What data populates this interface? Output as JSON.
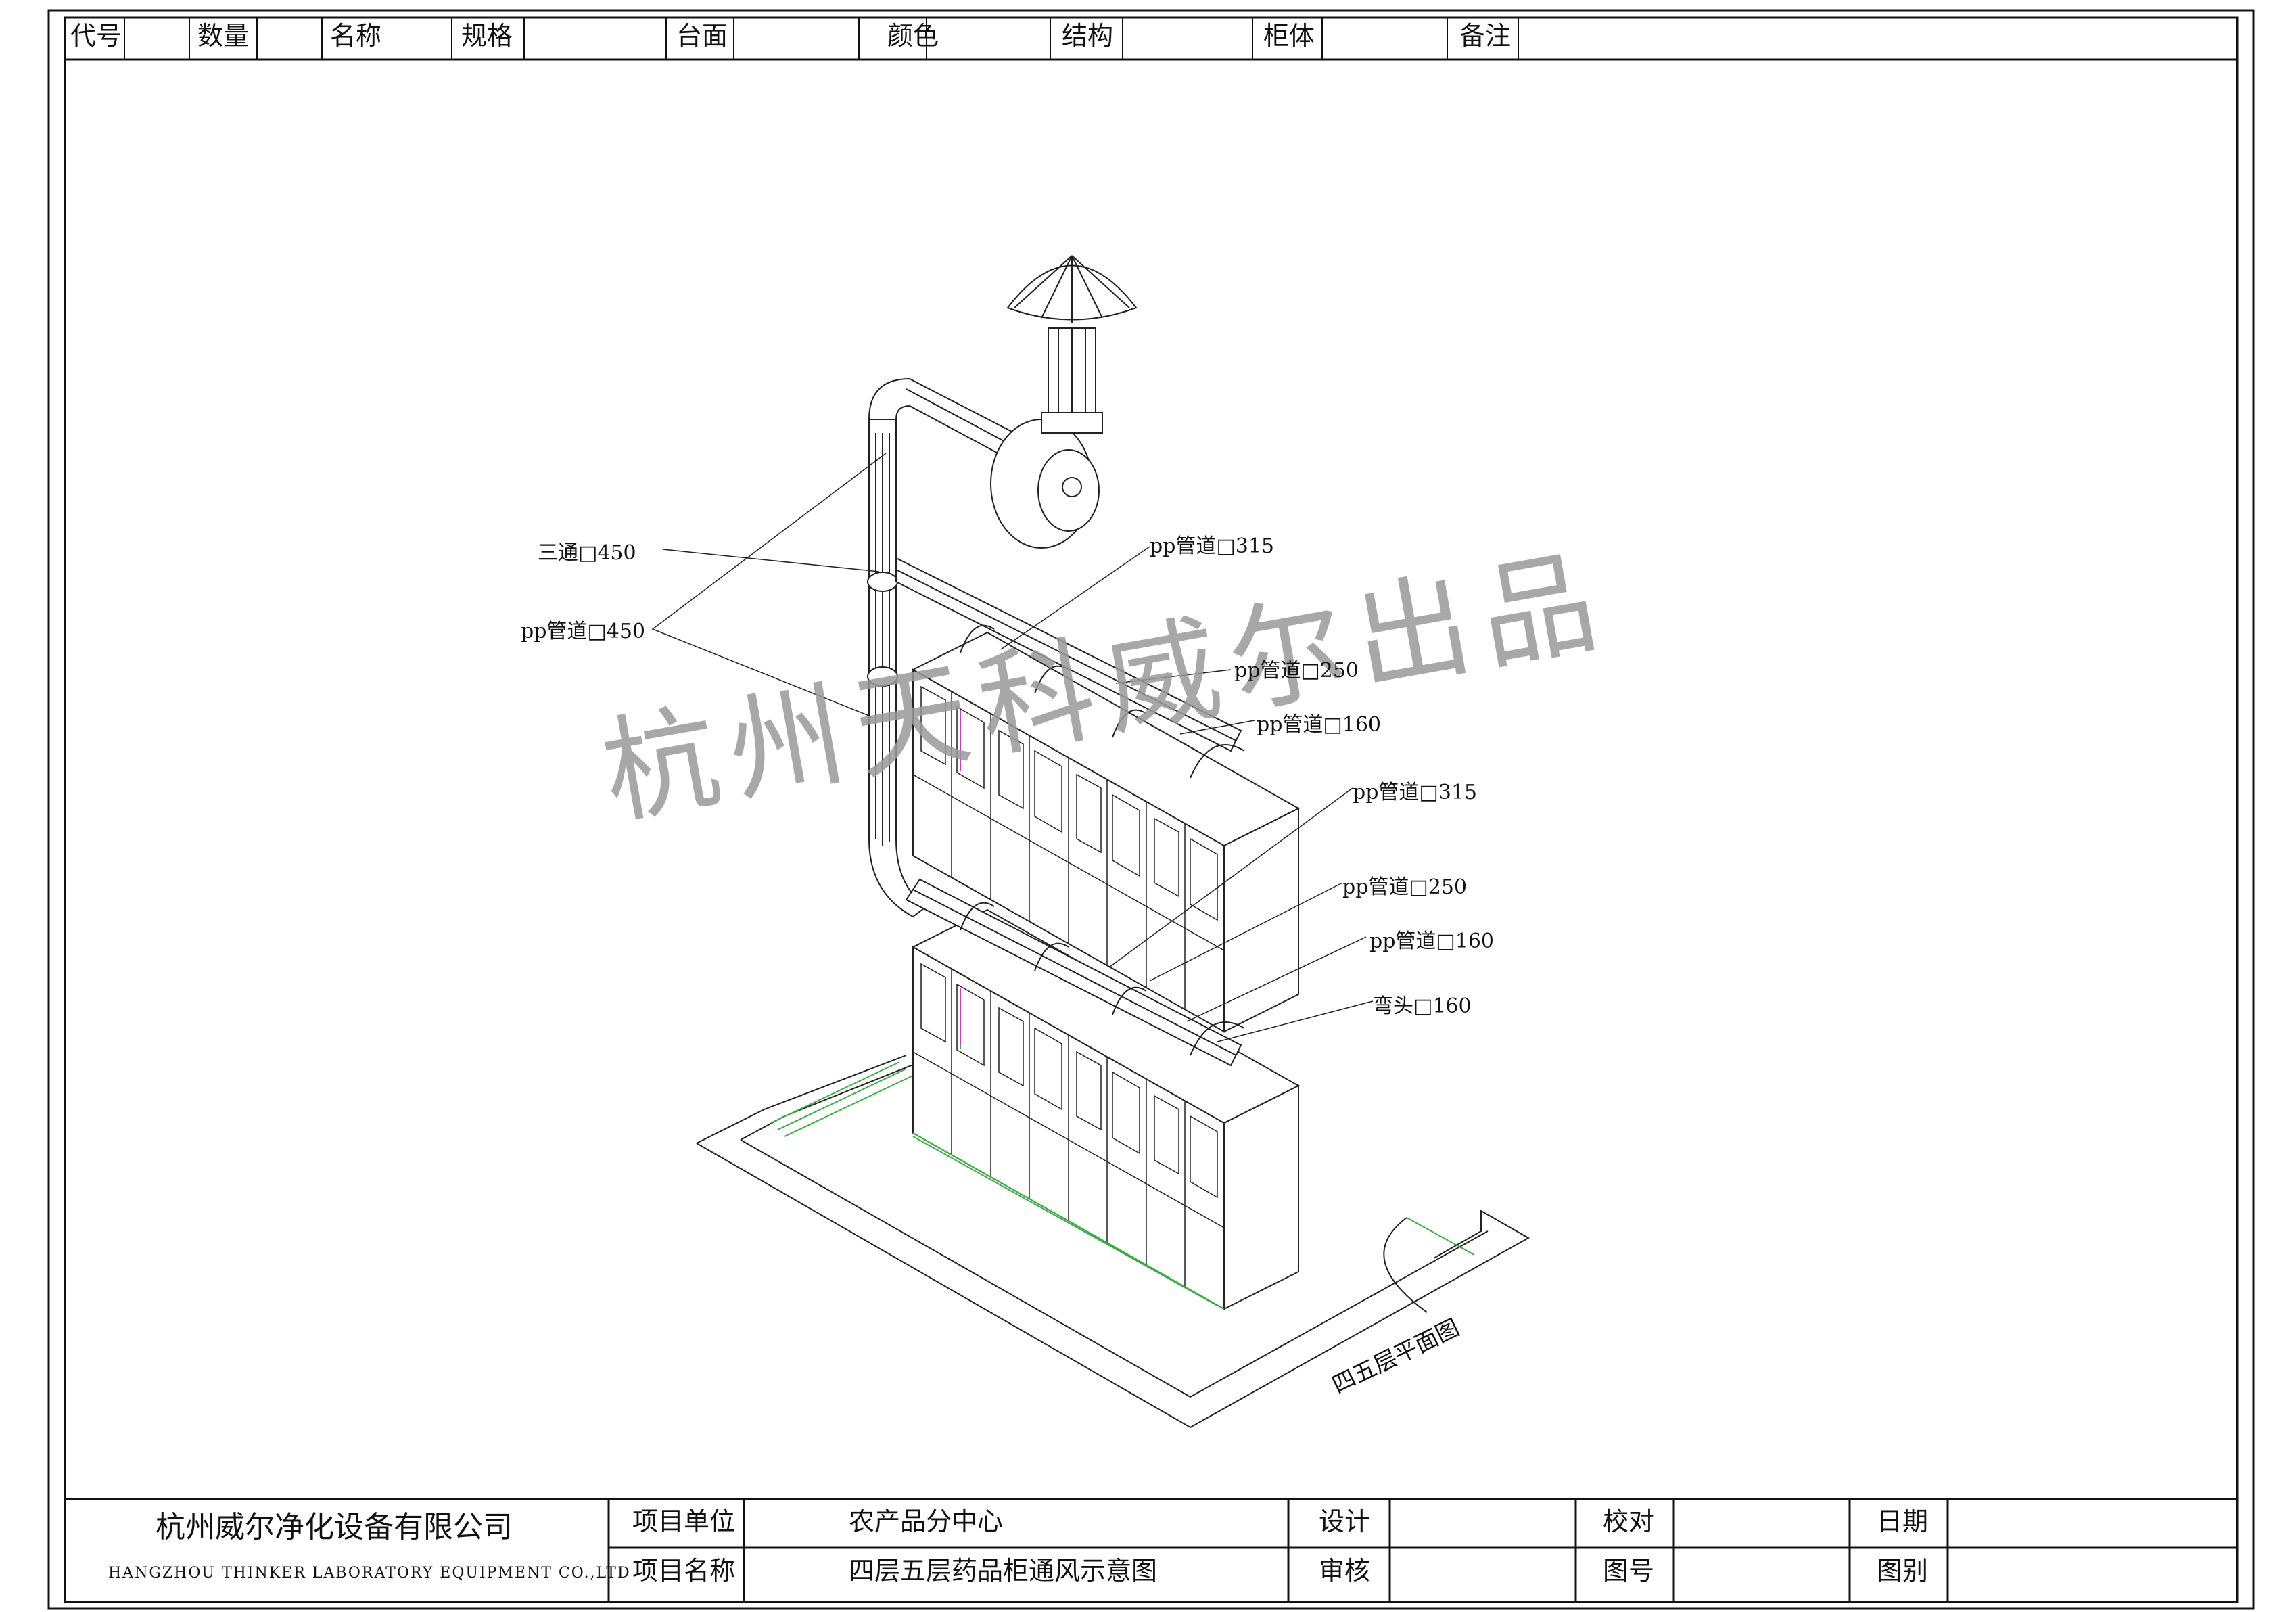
{
  "header_row": {
    "cells": [
      "代号",
      "数量",
      "名称",
      "规格",
      "台面",
      "颜色",
      "结构",
      "柜体",
      "备注"
    ]
  },
  "watermark": "杭州天科威尔出品",
  "annotations": [
    "三通□450",
    "pp管道□450",
    "pp管道□315",
    "pp管道□250",
    "pp管道□160",
    "pp管道□315",
    "pp管道□250",
    "pp管道□160",
    "弯头□160"
  ],
  "floor_plan_label": "四五层平面图",
  "title_block": {
    "company_cn": "杭州威尔净化设备有限公司",
    "company_en": "HANGZHOU THINKER LABORATORY EQUIPMENT CO.,LTD",
    "project_unit_label": "项目单位",
    "project_unit_value": "农产品分中心",
    "project_name_label": "项目名称",
    "project_name_value": "四层五层药品柜通风示意图",
    "design_label": "设计",
    "review_label": "审核",
    "check_label": "校对",
    "drawing_no_label": "图号",
    "date_label": "日期",
    "category_label": "图别"
  }
}
